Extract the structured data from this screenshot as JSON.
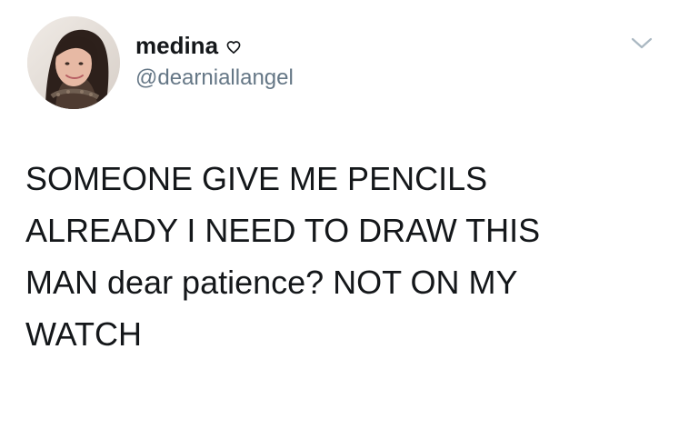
{
  "tweet": {
    "display_name": "medina",
    "handle": "@dearniallangel",
    "text": "SOMEONE GIVE ME PENCILS\nALREADY I NEED TO DRAW THIS\nMAN dear patience? NOT ON MY\nWATCH",
    "icons": {
      "verified_symbol": "heart-outline-icon",
      "menu": "chevron-down-icon",
      "avatar": "profile-photo"
    },
    "colors": {
      "name": "#14171a",
      "handle": "#657786",
      "chevron": "#aab8c2"
    }
  }
}
